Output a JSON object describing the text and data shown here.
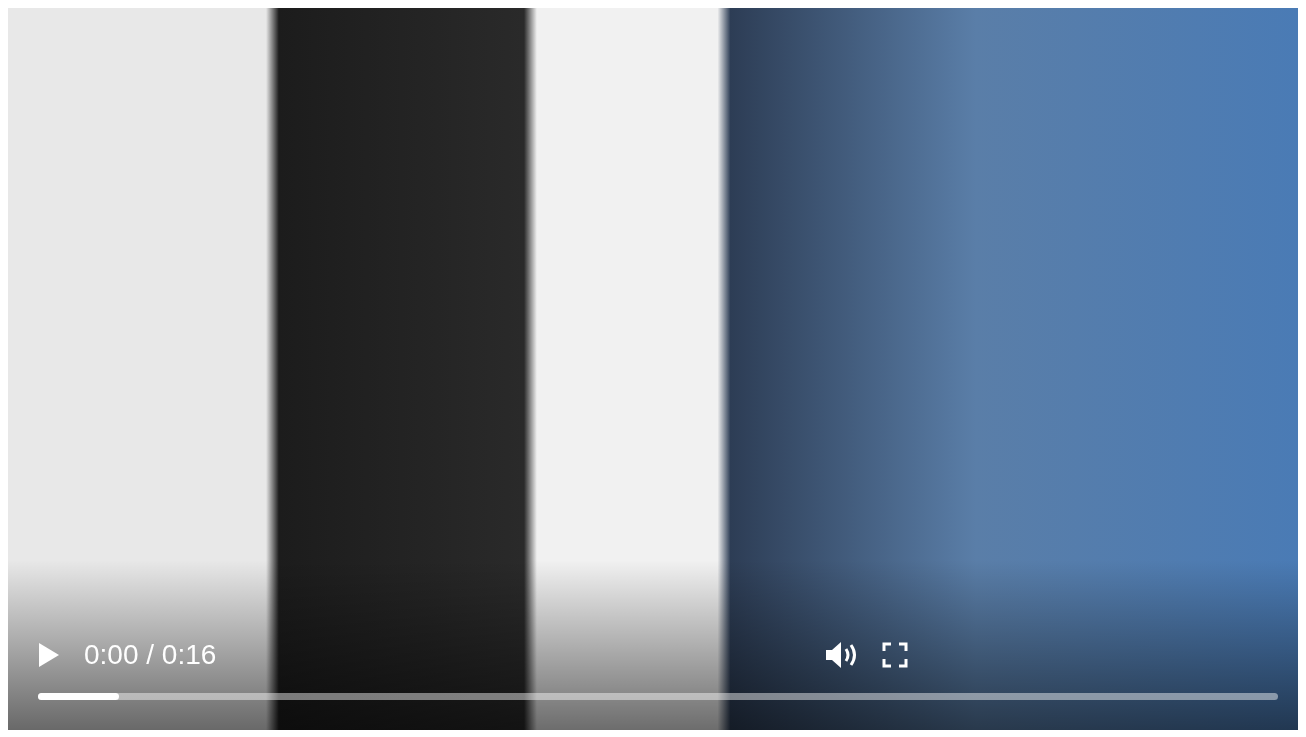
{
  "player": {
    "playing": false,
    "time": "0:00 / 0:16",
    "muted": false,
    "progress": {
      "level": 0.065
    }
  }
}
